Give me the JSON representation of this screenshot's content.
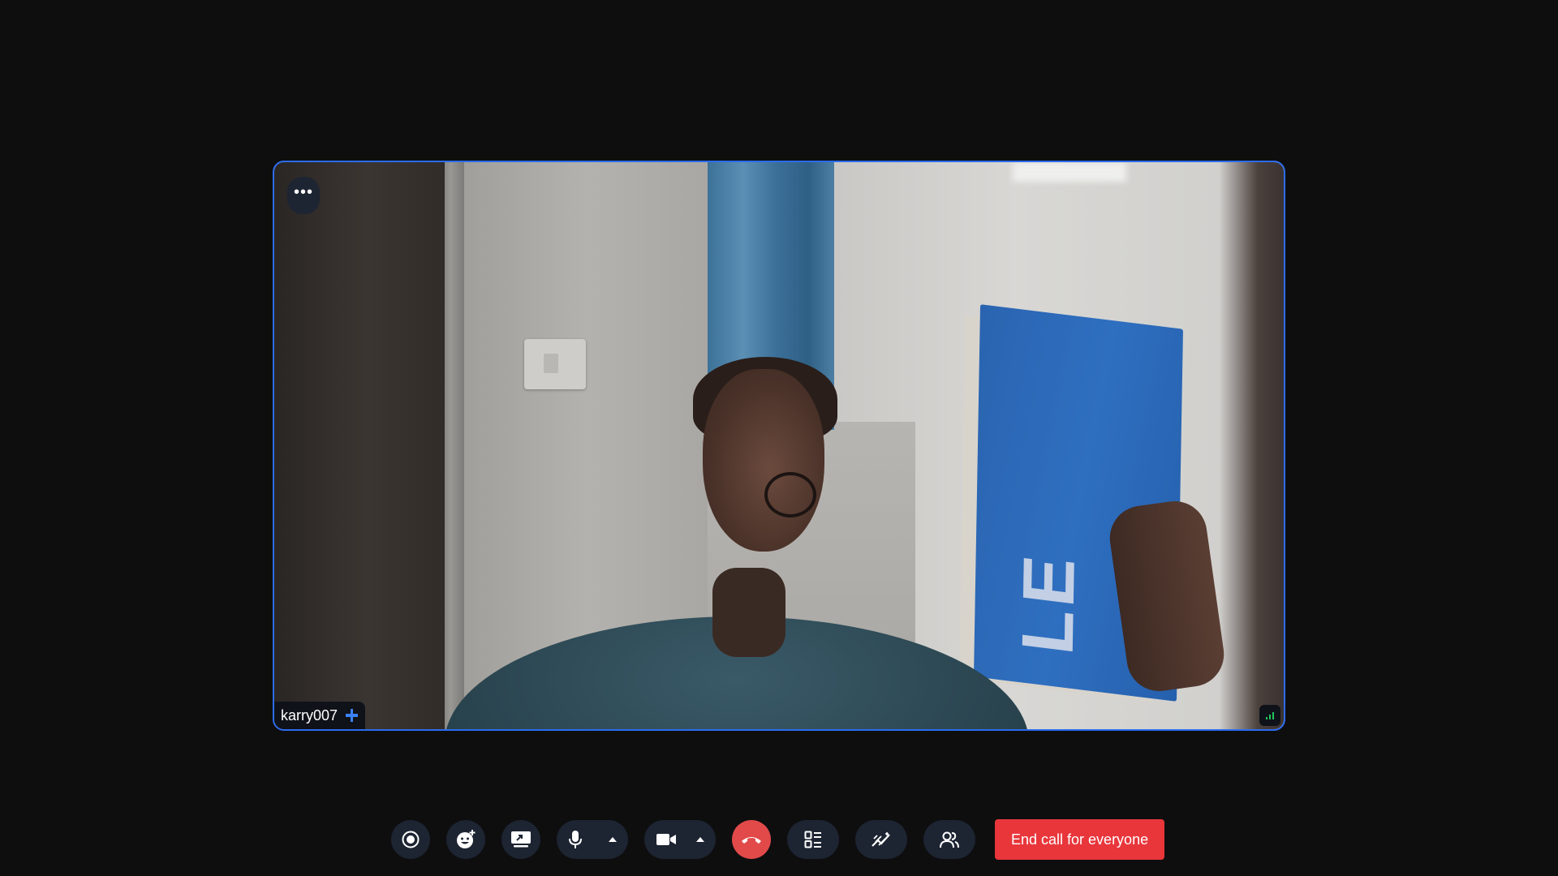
{
  "participant": {
    "name": "karry007",
    "pinned": true,
    "connection": "good"
  },
  "tile": {
    "menu_icon": "more-horizontal-icon",
    "accent": "#2b6cf0"
  },
  "controls": [
    {
      "id": "record",
      "icon": "record-icon"
    },
    {
      "id": "reactions",
      "icon": "emoji-add-icon"
    },
    {
      "id": "screen-share",
      "icon": "screen-share-icon"
    },
    {
      "id": "microphone",
      "icon": "microphone-icon",
      "has_menu": true
    },
    {
      "id": "camera",
      "icon": "video-camera-icon",
      "has_menu": true
    },
    {
      "id": "leave",
      "icon": "phone-hangup-icon",
      "color": "#e24a4a"
    },
    {
      "id": "layout",
      "icon": "layout-icon"
    },
    {
      "id": "whiteboard",
      "icon": "whiteboard-icon"
    },
    {
      "id": "participants",
      "icon": "participants-icon"
    }
  ],
  "end_call": {
    "label": "End call for everyone",
    "color": "#e8363b"
  }
}
